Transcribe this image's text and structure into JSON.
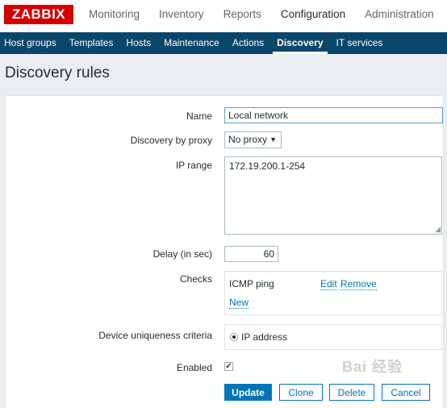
{
  "logo": "ZABBIX",
  "top_menu": [
    "Monitoring",
    "Inventory",
    "Reports",
    "Configuration",
    "Administration"
  ],
  "sub_menu": [
    "Host groups",
    "Templates",
    "Hosts",
    "Maintenance",
    "Actions",
    "Discovery",
    "IT services"
  ],
  "page_title": "Discovery rules",
  "form": {
    "name_label": "Name",
    "name_value": "Local network",
    "proxy_label": "Discovery by proxy",
    "proxy_value": "No proxy",
    "iprange_label": "IP range",
    "iprange_value": "172.19.200.1-254",
    "delay_label": "Delay (in sec)",
    "delay_value": "60",
    "checks_label": "Checks",
    "check_item": "ICMP ping",
    "edit_link": "Edit",
    "remove_link": "Remove",
    "new_link": "New",
    "uniqueness_label": "Device uniqueness criteria",
    "uniqueness_option": "IP address",
    "enabled_label": "Enabled",
    "enabled_checked": true
  },
  "buttons": {
    "update": "Update",
    "clone": "Clone",
    "delete": "Delete",
    "cancel": "Cancel"
  },
  "colors": {
    "brand_red": "#d40000",
    "subnav_blue": "#0a466a",
    "accent_blue": "#0275b8"
  },
  "watermark": "Bai 经验"
}
